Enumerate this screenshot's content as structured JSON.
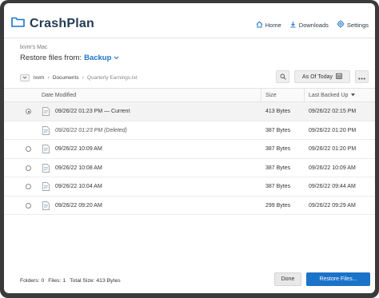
{
  "app": {
    "name": "CrashPlan",
    "brand_color": "#1a73c9"
  },
  "nav": {
    "home": "Home",
    "downloads": "Downloads",
    "settings": "Settings"
  },
  "machine_name": "lxvm's Mac",
  "restore": {
    "label": "Restore files from:",
    "target": "Backup"
  },
  "breadcrumb": {
    "items": [
      "lxvm",
      "Documents",
      "Quarterly Earnings.txt"
    ]
  },
  "toolbar": {
    "date_label": "As Of Today"
  },
  "table": {
    "headers": {
      "date": "Date Modified",
      "size": "Size",
      "backed": "Last Backed Up"
    },
    "rows": [
      {
        "date": "09/26/22 01:23 PM — Current",
        "size": "413 Bytes",
        "backed": "09/26/22 02:15 PM",
        "deleted": false,
        "selected": true
      },
      {
        "date": "09/26/22 01:23 PM (Deleted)",
        "size": "387 Bytes",
        "backed": "09/26/22 01:20 PM",
        "deleted": true,
        "selected": false
      },
      {
        "date": "09/26/22 10:09 AM",
        "size": "387 Bytes",
        "backed": "09/26/22 01:20 PM",
        "deleted": false,
        "selected": false
      },
      {
        "date": "09/26/22 10:08 AM",
        "size": "387 Bytes",
        "backed": "09/26/22 10:09 AM",
        "deleted": false,
        "selected": false
      },
      {
        "date": "09/26/22 10:04 AM",
        "size": "387 Bytes",
        "backed": "09/26/22 09:44 AM",
        "deleted": false,
        "selected": false
      },
      {
        "date": "09/26/22 09:20 AM",
        "size": "299 Bytes",
        "backed": "09/26/22 09:29 AM",
        "deleted": false,
        "selected": false
      }
    ]
  },
  "footer": {
    "folders": "Folders: 0",
    "files": "Files: 1",
    "total": "Total Size: 413 Bytes",
    "done": "Done",
    "restore": "Restore Files..."
  }
}
